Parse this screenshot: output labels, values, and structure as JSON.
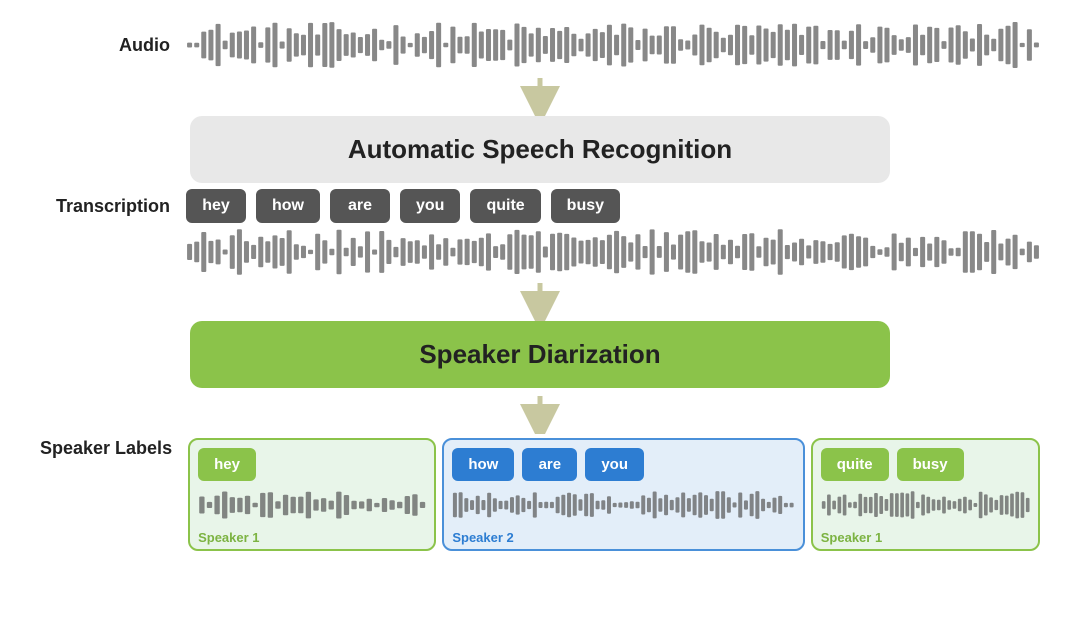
{
  "audio_label": "Audio",
  "transcription_label": "Transcription",
  "speaker_labels_label": "Speaker Labels",
  "asr_box_text": "Automatic Speech Recognition",
  "sd_box_text": "Speaker Diarization",
  "transcription_tokens": [
    "hey",
    "how",
    "are",
    "you",
    "quite",
    "busy"
  ],
  "speaker1_left_tokens": [
    "hey"
  ],
  "speaker2_tokens": [
    "how",
    "are",
    "you"
  ],
  "speaker1_right_tokens": [
    "quite",
    "busy"
  ],
  "speaker1_label": "Speaker 1",
  "speaker2_label": "Speaker 2",
  "arrow_color": "#c8c8a0",
  "colors": {
    "asr_bg": "#e8e8e8",
    "sd_bg": "#8bc34a",
    "token_dark": "#555555",
    "token_green": "#8bc34a",
    "token_blue": "#2d7dd2",
    "seg1_bg": "#e8f5e9",
    "seg2_bg": "#e3eef9",
    "label_green": "#7cb342",
    "label_blue": "#2d7dd2"
  }
}
